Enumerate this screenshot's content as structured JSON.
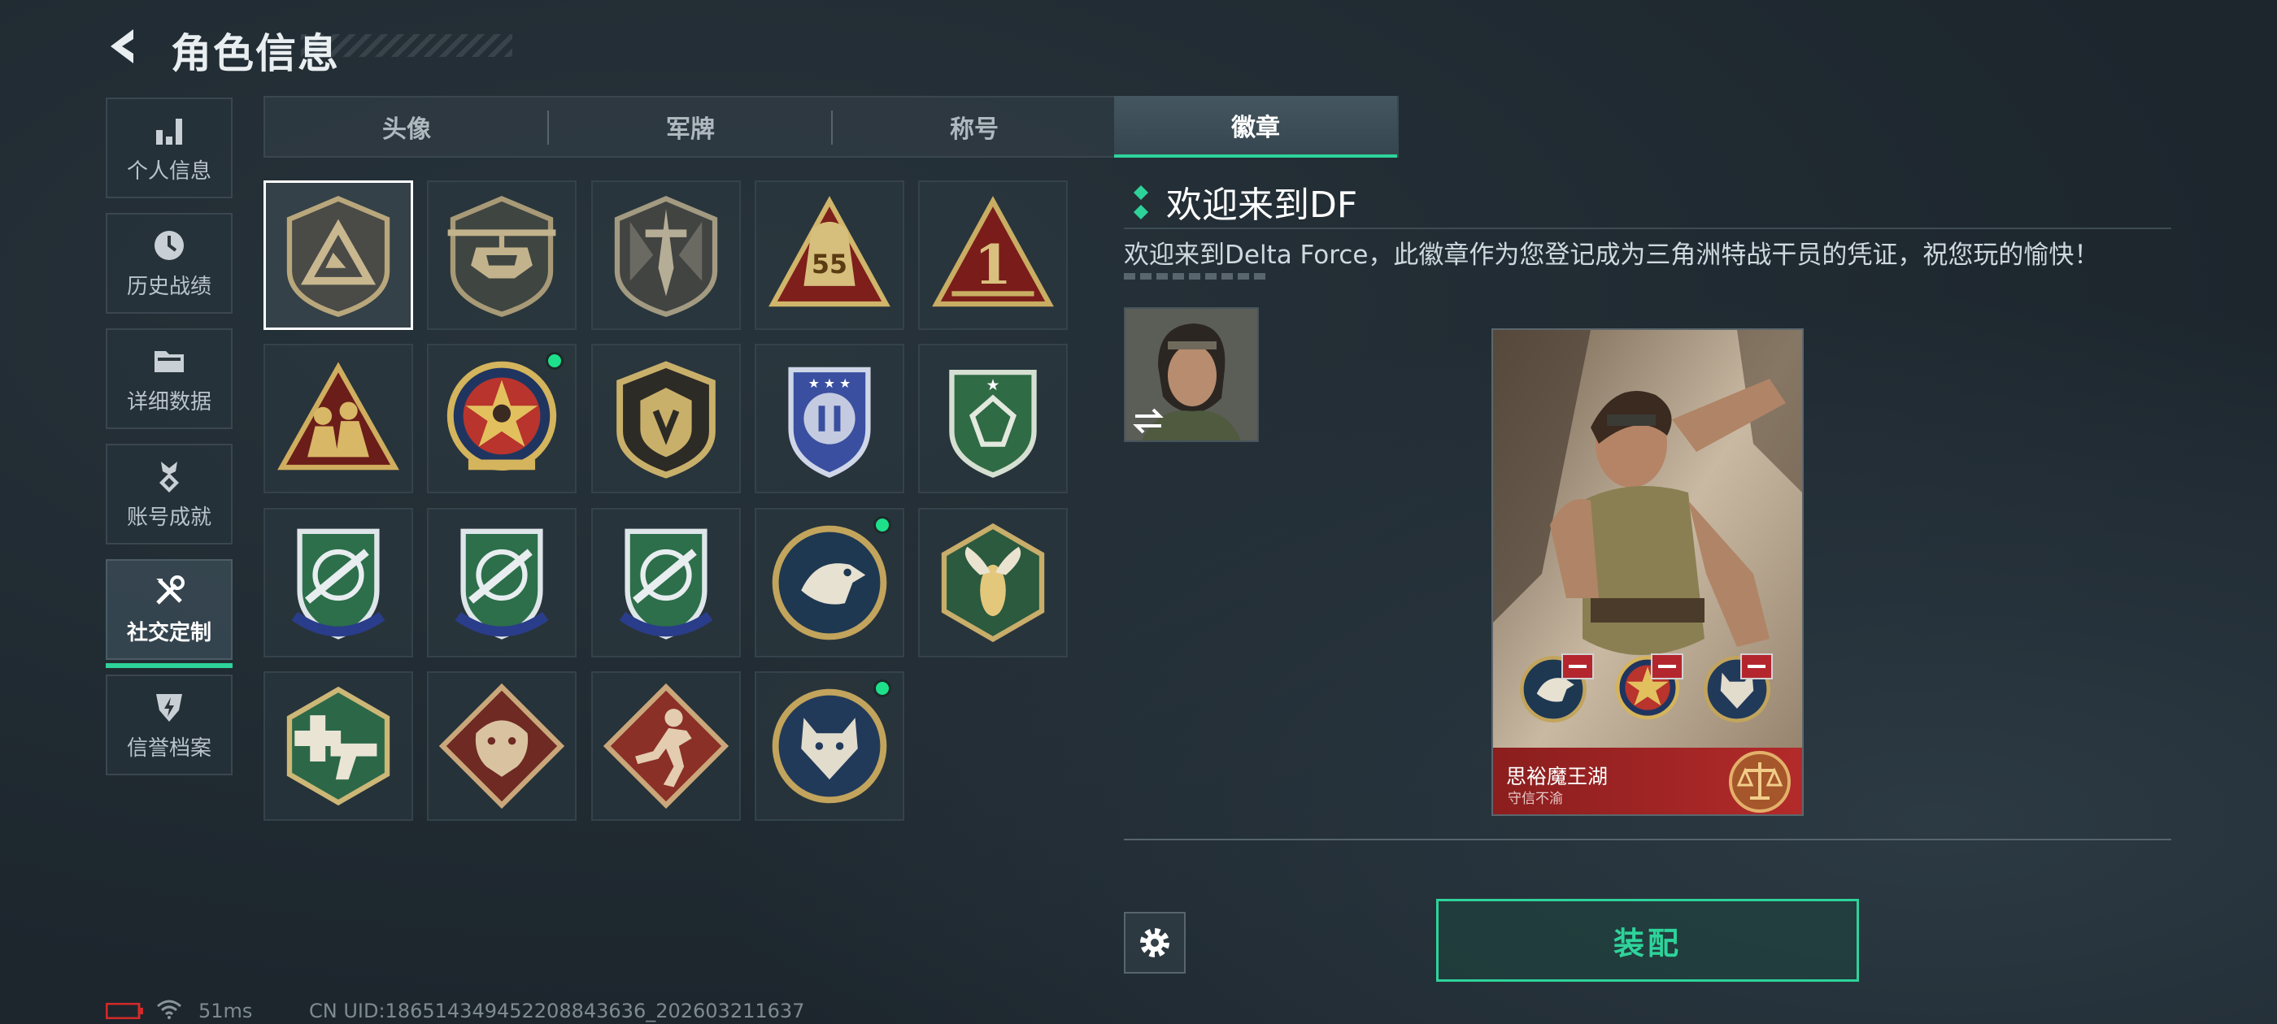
{
  "header": {
    "title": "角色信息"
  },
  "sidebar": {
    "items": [
      {
        "label": "个人信息",
        "icon": "bar-chart-icon"
      },
      {
        "label": "历史战绩",
        "icon": "clock-icon"
      },
      {
        "label": "详细数据",
        "icon": "folder-icon"
      },
      {
        "label": "账号成就",
        "icon": "medal-icon"
      },
      {
        "label": "社交定制",
        "icon": "tools-icon",
        "active": true
      },
      {
        "label": "信誉档案",
        "icon": "shield-bolt-icon"
      }
    ]
  },
  "tabs": [
    {
      "label": "头像"
    },
    {
      "label": "军牌"
    },
    {
      "label": "称号"
    },
    {
      "label": "徽章",
      "active": true
    }
  ],
  "badges": [
    {
      "icon": "delta-triangle-badge-icon",
      "selected": true
    },
    {
      "icon": "helicopter-badge-icon"
    },
    {
      "icon": "dagger-shield-badge-icon"
    },
    {
      "icon": "bag-55-badge-icon",
      "text": "55"
    },
    {
      "icon": "number-one-badge-icon",
      "text": "1"
    },
    {
      "icon": "soldiers-badge-icon"
    },
    {
      "icon": "star-skull-badge-icon",
      "new": true
    },
    {
      "icon": "gold-shield-badge-icon"
    },
    {
      "icon": "blue-crest-badge-icon"
    },
    {
      "icon": "green-gem-crest-badge-icon"
    },
    {
      "icon": "rifle-crest-badge-icon-1"
    },
    {
      "icon": "rifle-crest-badge-icon-2"
    },
    {
      "icon": "rifle-crest-badge-icon-3"
    },
    {
      "icon": "eagle-badge-icon",
      "new": true
    },
    {
      "icon": "wasp-badge-icon"
    },
    {
      "icon": "medic-gun-badge-icon"
    },
    {
      "icon": "dragon-badge-icon"
    },
    {
      "icon": "runner-badge-icon"
    },
    {
      "icon": "wolf-badge-icon",
      "new": true
    }
  ],
  "detail": {
    "name": "欢迎来到DF",
    "description": "欢迎来到Delta Force，此徽章作为您登记成为三角洲特战干员的凭证，祝您玩的愉快！"
  },
  "card": {
    "player_name": "思裕魔王湖",
    "player_title": "守信不渝",
    "equipped_badges": [
      "eagle-badge-icon",
      "star-skull-badge-icon",
      "wolf-badge-icon"
    ]
  },
  "actions": {
    "equip_label": "装配"
  },
  "status": {
    "ping": "51ms",
    "uid": "CN UID:1865143494522088436​36_202603211637"
  },
  "colors": {
    "accent": "#2ed39a",
    "card_red": "#b32a2a",
    "new_dot": "#1ee08a"
  }
}
